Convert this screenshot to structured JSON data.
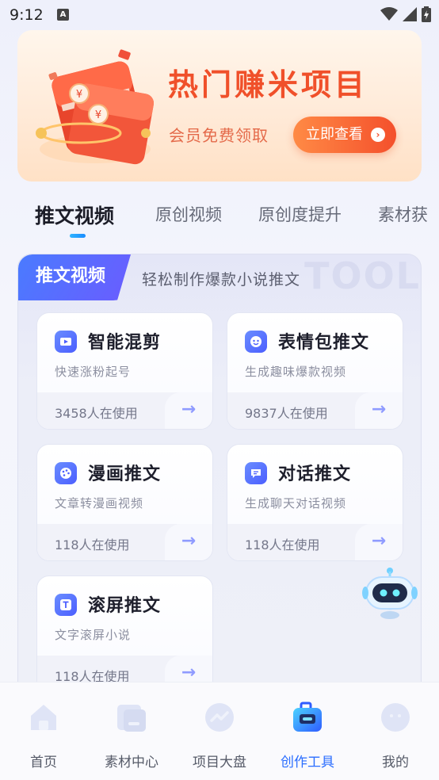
{
  "status_bar": {
    "time": "9:12",
    "notification_icon": "A"
  },
  "banner": {
    "title": "热门赚米项目",
    "subtitle": "会员免费领取",
    "button_label": "立即查看"
  },
  "tabs": [
    {
      "label": "推文视频",
      "active": true
    },
    {
      "label": "原创视频",
      "active": false
    },
    {
      "label": "原创度提升",
      "active": false
    },
    {
      "label": "素材获",
      "active": false
    }
  ],
  "section": {
    "badge": "推文视频",
    "subtitle": "轻松制作爆款小说推文",
    "watermark": "TOOL"
  },
  "tools": [
    {
      "title": "智能混剪",
      "desc": "快速涨粉起号",
      "count": "3458人在使用",
      "icon": "video-play-icon"
    },
    {
      "title": "表情包推文",
      "desc": "生成趣味爆款视频",
      "count": "9837人在使用",
      "icon": "emoji-icon"
    },
    {
      "title": "漫画推文",
      "desc": "文章转漫画视频",
      "count": "118人在使用",
      "icon": "palette-icon"
    },
    {
      "title": "对话推文",
      "desc": "生成聊天对话视频",
      "count": "118人在使用",
      "icon": "chat-icon"
    },
    {
      "title": "滚屏推文",
      "desc": "文字滚屏小说",
      "count": "118人在使用",
      "icon": "text-icon"
    }
  ],
  "bottom_nav": [
    {
      "label": "首页",
      "icon": "home-icon",
      "active": false
    },
    {
      "label": "素材中心",
      "icon": "folder-icon",
      "active": false
    },
    {
      "label": "项目大盘",
      "icon": "trend-icon",
      "active": false
    },
    {
      "label": "创作工具",
      "icon": "toolbox-icon",
      "active": true
    },
    {
      "label": "我的",
      "icon": "profile-icon",
      "active": false
    }
  ],
  "colors": {
    "accent": "#2a6dff",
    "banner_title": "#f0502a",
    "banner_button": "#f4502c"
  }
}
